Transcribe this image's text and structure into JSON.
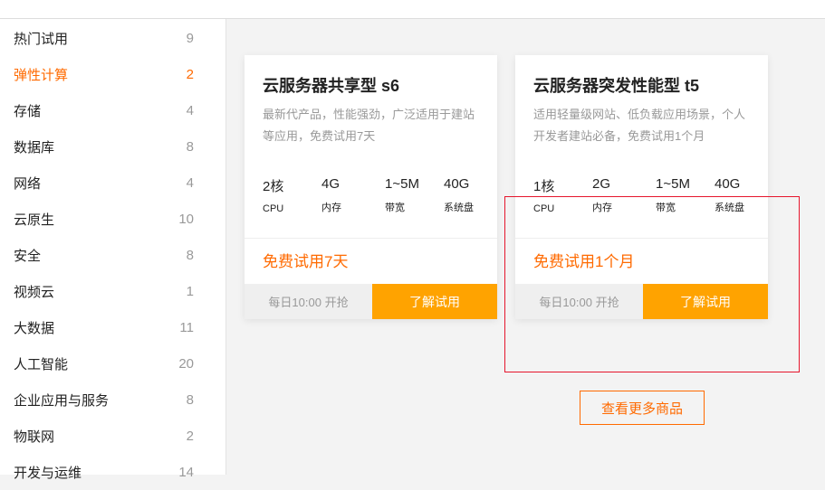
{
  "sidebar": {
    "items": [
      {
        "label": "热门试用",
        "count": "9"
      },
      {
        "label": "弹性计算",
        "count": "2"
      },
      {
        "label": "存储",
        "count": "4"
      },
      {
        "label": "数据库",
        "count": "8"
      },
      {
        "label": "网络",
        "count": "4"
      },
      {
        "label": "云原生",
        "count": "10"
      },
      {
        "label": "安全",
        "count": "8"
      },
      {
        "label": "视频云",
        "count": "1"
      },
      {
        "label": "大数据",
        "count": "11"
      },
      {
        "label": "人工智能",
        "count": "20"
      },
      {
        "label": "企业应用与服务",
        "count": "8"
      },
      {
        "label": "物联网",
        "count": "2"
      },
      {
        "label": "开发与运维",
        "count": "14"
      }
    ],
    "active_index": 1
  },
  "cards": [
    {
      "title": "云服务器共享型 s6",
      "desc": "最新代产品，性能强劲，广泛适用于建站等应用，免费试用7天",
      "specs": [
        {
          "v": "2核",
          "l": "CPU"
        },
        {
          "v": "4G",
          "l": "内存"
        },
        {
          "v": "1~5M",
          "l": "带宽"
        },
        {
          "v": "40G",
          "l": "系统盘"
        }
      ],
      "free": "免费试用7天",
      "time": "每日10:00 开抢",
      "button": "了解试用"
    },
    {
      "title": "云服务器突发性能型 t5",
      "desc": "适用轻量级网站、低负载应用场景，个人开发者建站必备，免费试用1个月",
      "specs": [
        {
          "v": "1核",
          "l": "CPU"
        },
        {
          "v": "2G",
          "l": "内存"
        },
        {
          "v": "1~5M",
          "l": "带宽"
        },
        {
          "v": "40G",
          "l": "系统盘"
        }
      ],
      "free": "免费试用1个月",
      "time": "每日10:00 开抢",
      "button": "了解试用"
    }
  ],
  "more_button": "查看更多商品",
  "colors": {
    "accent": "#ff6a00",
    "button": "#ffa300",
    "highlight": "#e6162d"
  }
}
